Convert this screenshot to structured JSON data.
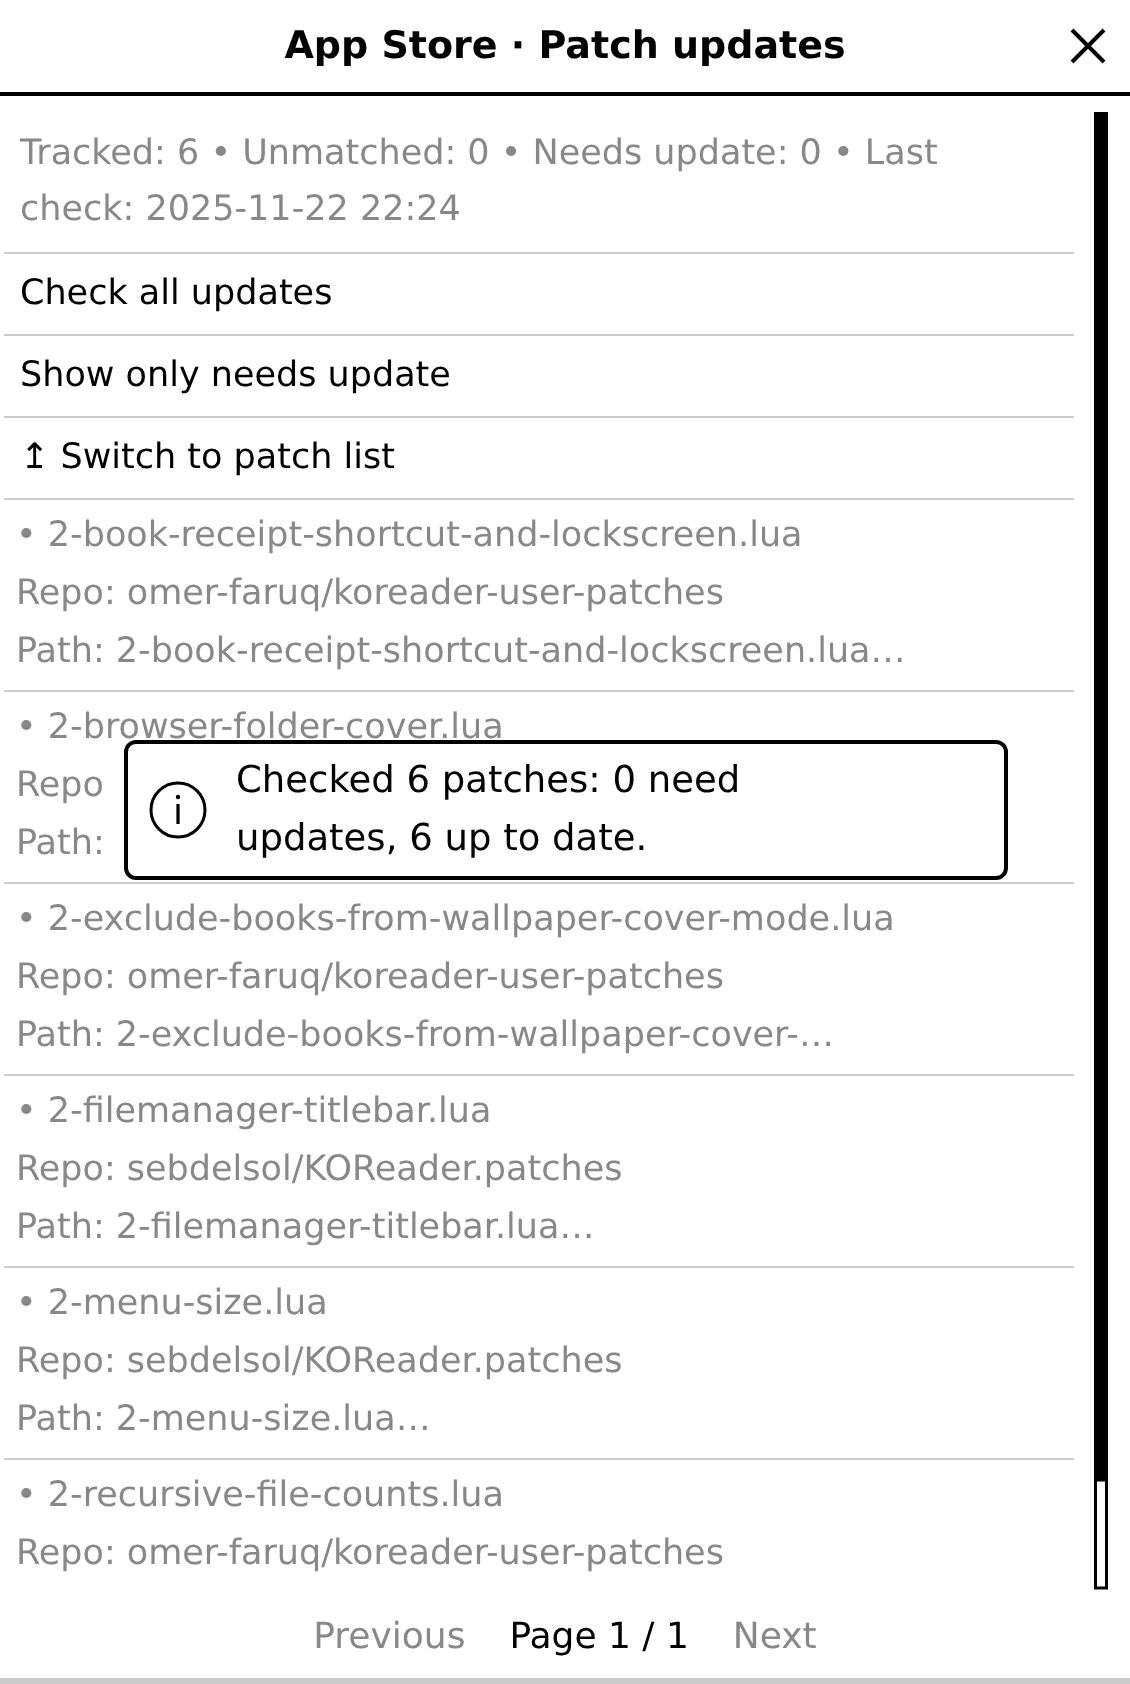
{
  "window": {
    "title": "App Store · Patch updates"
  },
  "summary": "Tracked: 6 • Unmatched: 0 • Needs update: 0 • Last check: 2025-11-22 22:24",
  "actions": [
    {
      "label": "Check all updates"
    },
    {
      "label": "Show only needs update"
    },
    {
      "label": "↥ Switch to patch list"
    }
  ],
  "patches": [
    {
      "name": "• 2-book-receipt-shortcut-and-lockscreen.lua",
      "repo": "Repo: omer-faruq/koreader-user-patches",
      "path": "Path: 2-book-receipt-shortcut-and-lockscreen.lua…"
    },
    {
      "name": "• 2-browser-folder-cover.lua",
      "repo": "Repo",
      "path": "Path:"
    },
    {
      "name": "• 2-exclude-books-from-wallpaper-cover-mode.lua",
      "repo": "Repo: omer-faruq/koreader-user-patches",
      "path": "Path: 2-exclude-books-from-wallpaper-cover-…"
    },
    {
      "name": "• 2-filemanager-titlebar.lua",
      "repo": "Repo: sebdelsol/KOReader.patches",
      "path": "Path: 2-filemanager-titlebar.lua…"
    },
    {
      "name": "• 2-menu-size.lua",
      "repo": "Repo: sebdelsol/KOReader.patches",
      "path": "Path: 2-menu-size.lua…"
    },
    {
      "name": "• 2-recursive-file-counts.lua",
      "repo": "Repo: omer-faruq/koreader-user-patches"
    }
  ],
  "toast": {
    "message": "Checked 6 patches: 0 need updates, 6 up to date."
  },
  "pagination": {
    "previous": {
      "label": "Previous",
      "disabled": true
    },
    "page": "Page 1 / 1",
    "next": {
      "label": "Next",
      "disabled": true
    }
  }
}
